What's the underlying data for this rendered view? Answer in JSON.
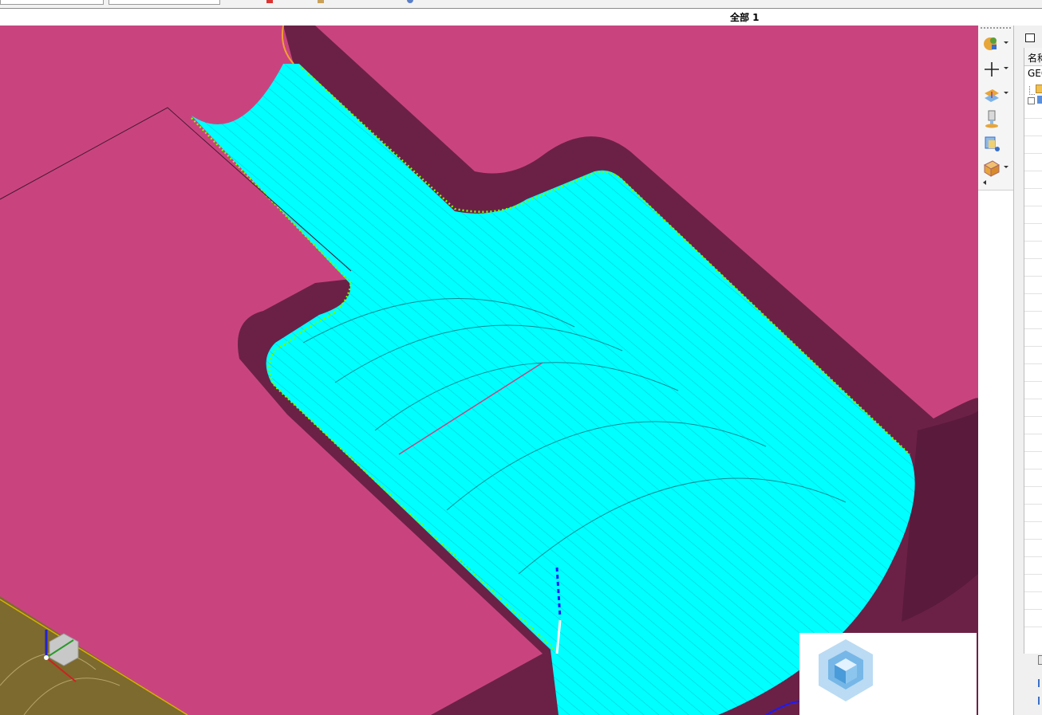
{
  "status_bar": {
    "text": "全部 1"
  },
  "navigator": {
    "header": "名称",
    "items": [
      {
        "label": "GEOMETRY"
      }
    ]
  },
  "toolbar": {
    "tools": [
      {
        "name": "create-program-tool",
        "icon": "program-icon",
        "has_dropdown": true
      },
      {
        "name": "create-geometry-tool",
        "icon": "plus-icon",
        "has_dropdown": true
      },
      {
        "name": "create-operation-tool",
        "icon": "operation-icon",
        "has_dropdown": true
      },
      {
        "name": "create-tool-tool",
        "icon": "tool-holder-icon",
        "has_dropdown": false
      },
      {
        "name": "create-method-tool",
        "icon": "method-icon",
        "has_dropdown": false
      },
      {
        "name": "workpiece-tool",
        "icon": "workpiece-icon",
        "has_dropdown": true
      }
    ]
  },
  "colors": {
    "part_surface": "#c9447f",
    "pocket_wall": "#6b2146",
    "toolpath": "#00ffff",
    "contact_points": "#7cfc00",
    "wcs_plane": "#7d6a2e"
  }
}
